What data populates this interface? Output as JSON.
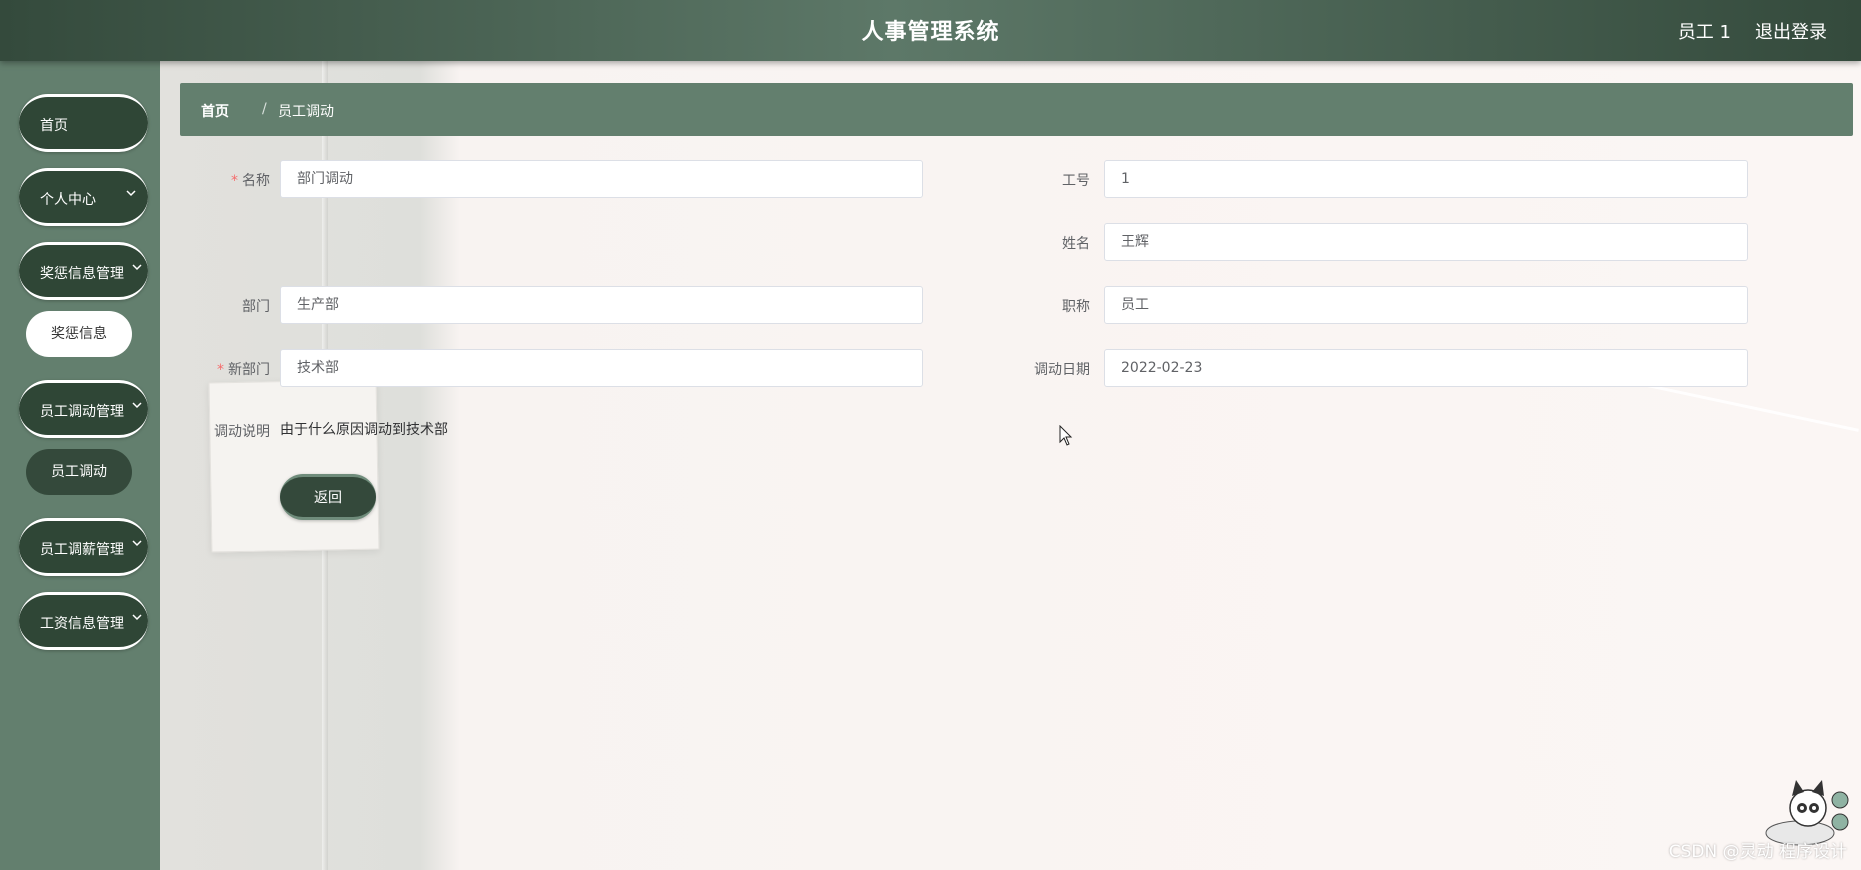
{
  "header": {
    "title": "人事管理系统",
    "user": "员工 1",
    "logout": "退出登录"
  },
  "sidebar": {
    "items": [
      {
        "label": "首页",
        "has_chevron": false
      },
      {
        "label": "个人中心",
        "has_chevron": true
      },
      {
        "label": "奖惩信息管理",
        "has_chevron": true
      },
      {
        "label": "员工调动管理",
        "has_chevron": true
      },
      {
        "label": "员工调薪管理",
        "has_chevron": true
      },
      {
        "label": "工资信息管理",
        "has_chevron": true
      }
    ],
    "subitems": [
      {
        "label": "奖惩信息",
        "active": false
      },
      {
        "label": "员工调动",
        "active": true
      }
    ]
  },
  "breadcrumb": {
    "home": "首页",
    "separator": "/",
    "current": "员工调动"
  },
  "form": {
    "name": {
      "label": "名称",
      "required": true,
      "value": "部门调动"
    },
    "job_no": {
      "label": "工号",
      "required": false,
      "value": "1"
    },
    "full_name": {
      "label": "姓名",
      "required": false,
      "value": "王辉"
    },
    "department": {
      "label": "部门",
      "required": false,
      "value": "生产部"
    },
    "title": {
      "label": "职称",
      "required": false,
      "value": "员工"
    },
    "new_department": {
      "label": "新部门",
      "required": true,
      "value": "技术部"
    },
    "transfer_date": {
      "label": "调动日期",
      "required": false,
      "value": "2022-02-23"
    },
    "description": {
      "label": "调动说明",
      "value": "由于什么原因调动到技术部"
    },
    "back_button": "返回",
    "required_mark": "*"
  },
  "watermark": "CSDN @灵动 程序设计",
  "colors": {
    "header_dark": "#344a3c",
    "sidebar": "#637f6e",
    "pill_dark": "#2f4636",
    "required": "#f56c6c"
  }
}
